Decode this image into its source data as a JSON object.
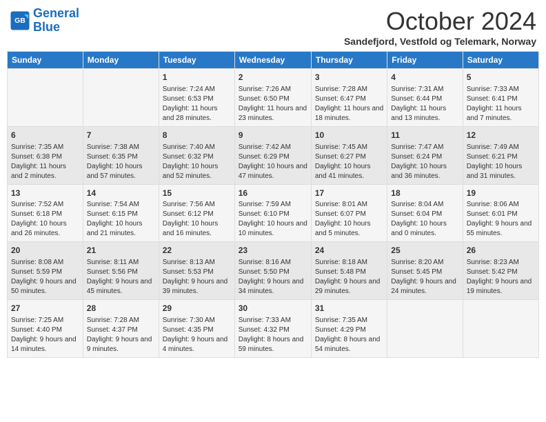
{
  "header": {
    "logo_line1": "General",
    "logo_line2": "Blue",
    "month": "October 2024",
    "location": "Sandefjord, Vestfold og Telemark, Norway"
  },
  "days_of_week": [
    "Sunday",
    "Monday",
    "Tuesday",
    "Wednesday",
    "Thursday",
    "Friday",
    "Saturday"
  ],
  "weeks": [
    [
      {
        "day": "",
        "info": ""
      },
      {
        "day": "",
        "info": ""
      },
      {
        "day": "1",
        "info": "Sunrise: 7:24 AM\nSunset: 6:53 PM\nDaylight: 11 hours and 28 minutes."
      },
      {
        "day": "2",
        "info": "Sunrise: 7:26 AM\nSunset: 6:50 PM\nDaylight: 11 hours and 23 minutes."
      },
      {
        "day": "3",
        "info": "Sunrise: 7:28 AM\nSunset: 6:47 PM\nDaylight: 11 hours and 18 minutes."
      },
      {
        "day": "4",
        "info": "Sunrise: 7:31 AM\nSunset: 6:44 PM\nDaylight: 11 hours and 13 minutes."
      },
      {
        "day": "5",
        "info": "Sunrise: 7:33 AM\nSunset: 6:41 PM\nDaylight: 11 hours and 7 minutes."
      }
    ],
    [
      {
        "day": "6",
        "info": "Sunrise: 7:35 AM\nSunset: 6:38 PM\nDaylight: 11 hours and 2 minutes."
      },
      {
        "day": "7",
        "info": "Sunrise: 7:38 AM\nSunset: 6:35 PM\nDaylight: 10 hours and 57 minutes."
      },
      {
        "day": "8",
        "info": "Sunrise: 7:40 AM\nSunset: 6:32 PM\nDaylight: 10 hours and 52 minutes."
      },
      {
        "day": "9",
        "info": "Sunrise: 7:42 AM\nSunset: 6:29 PM\nDaylight: 10 hours and 47 minutes."
      },
      {
        "day": "10",
        "info": "Sunrise: 7:45 AM\nSunset: 6:27 PM\nDaylight: 10 hours and 41 minutes."
      },
      {
        "day": "11",
        "info": "Sunrise: 7:47 AM\nSunset: 6:24 PM\nDaylight: 10 hours and 36 minutes."
      },
      {
        "day": "12",
        "info": "Sunrise: 7:49 AM\nSunset: 6:21 PM\nDaylight: 10 hours and 31 minutes."
      }
    ],
    [
      {
        "day": "13",
        "info": "Sunrise: 7:52 AM\nSunset: 6:18 PM\nDaylight: 10 hours and 26 minutes."
      },
      {
        "day": "14",
        "info": "Sunrise: 7:54 AM\nSunset: 6:15 PM\nDaylight: 10 hours and 21 minutes."
      },
      {
        "day": "15",
        "info": "Sunrise: 7:56 AM\nSunset: 6:12 PM\nDaylight: 10 hours and 16 minutes."
      },
      {
        "day": "16",
        "info": "Sunrise: 7:59 AM\nSunset: 6:10 PM\nDaylight: 10 hours and 10 minutes."
      },
      {
        "day": "17",
        "info": "Sunrise: 8:01 AM\nSunset: 6:07 PM\nDaylight: 10 hours and 5 minutes."
      },
      {
        "day": "18",
        "info": "Sunrise: 8:04 AM\nSunset: 6:04 PM\nDaylight: 10 hours and 0 minutes."
      },
      {
        "day": "19",
        "info": "Sunrise: 8:06 AM\nSunset: 6:01 PM\nDaylight: 9 hours and 55 minutes."
      }
    ],
    [
      {
        "day": "20",
        "info": "Sunrise: 8:08 AM\nSunset: 5:59 PM\nDaylight: 9 hours and 50 minutes."
      },
      {
        "day": "21",
        "info": "Sunrise: 8:11 AM\nSunset: 5:56 PM\nDaylight: 9 hours and 45 minutes."
      },
      {
        "day": "22",
        "info": "Sunrise: 8:13 AM\nSunset: 5:53 PM\nDaylight: 9 hours and 39 minutes."
      },
      {
        "day": "23",
        "info": "Sunrise: 8:16 AM\nSunset: 5:50 PM\nDaylight: 9 hours and 34 minutes."
      },
      {
        "day": "24",
        "info": "Sunrise: 8:18 AM\nSunset: 5:48 PM\nDaylight: 9 hours and 29 minutes."
      },
      {
        "day": "25",
        "info": "Sunrise: 8:20 AM\nSunset: 5:45 PM\nDaylight: 9 hours and 24 minutes."
      },
      {
        "day": "26",
        "info": "Sunrise: 8:23 AM\nSunset: 5:42 PM\nDaylight: 9 hours and 19 minutes."
      }
    ],
    [
      {
        "day": "27",
        "info": "Sunrise: 7:25 AM\nSunset: 4:40 PM\nDaylight: 9 hours and 14 minutes."
      },
      {
        "day": "28",
        "info": "Sunrise: 7:28 AM\nSunset: 4:37 PM\nDaylight: 9 hours and 9 minutes."
      },
      {
        "day": "29",
        "info": "Sunrise: 7:30 AM\nSunset: 4:35 PM\nDaylight: 9 hours and 4 minutes."
      },
      {
        "day": "30",
        "info": "Sunrise: 7:33 AM\nSunset: 4:32 PM\nDaylight: 8 hours and 59 minutes."
      },
      {
        "day": "31",
        "info": "Sunrise: 7:35 AM\nSunset: 4:29 PM\nDaylight: 8 hours and 54 minutes."
      },
      {
        "day": "",
        "info": ""
      },
      {
        "day": "",
        "info": ""
      }
    ]
  ]
}
